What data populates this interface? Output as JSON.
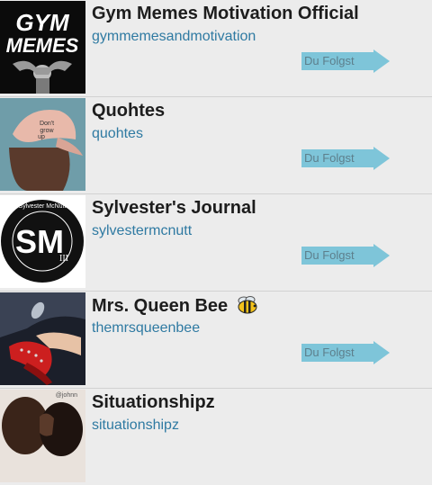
{
  "follow_label": "Du Folgst",
  "colors": {
    "background": "#ececec",
    "handle": "#2f7aa2",
    "follow_arrow": "#7ec5d9",
    "name": "#1d1d1d"
  },
  "accounts": [
    {
      "name": "Gym Memes Motivation Official",
      "handle": "gymmemesandmotivation",
      "avatar_text": [
        "GYM",
        "MEMES"
      ],
      "avatar_icon": "gym-memes-logo"
    },
    {
      "name": "Quohtes",
      "handle": "quohtes",
      "avatar_text": [
        "Don't",
        "grow",
        "up"
      ],
      "avatar_icon": "pink-cap-photo"
    },
    {
      "name": "Sylvester's Journal",
      "handle": "sylvestermcnutt",
      "avatar_text": [
        "Sylvester McNutt",
        "SM",
        "III"
      ],
      "avatar_icon": "sm-monogram-logo"
    },
    {
      "name": "Mrs. Queen Bee",
      "handle": "themrsqueenbee",
      "name_emoji": "bee-emoji",
      "avatar_icon": "red-heels-photo"
    },
    {
      "name": "Situationshipz",
      "handle": "situationshipz",
      "avatar_text": [
        "@johnn"
      ],
      "avatar_icon": "couple-photo"
    }
  ]
}
